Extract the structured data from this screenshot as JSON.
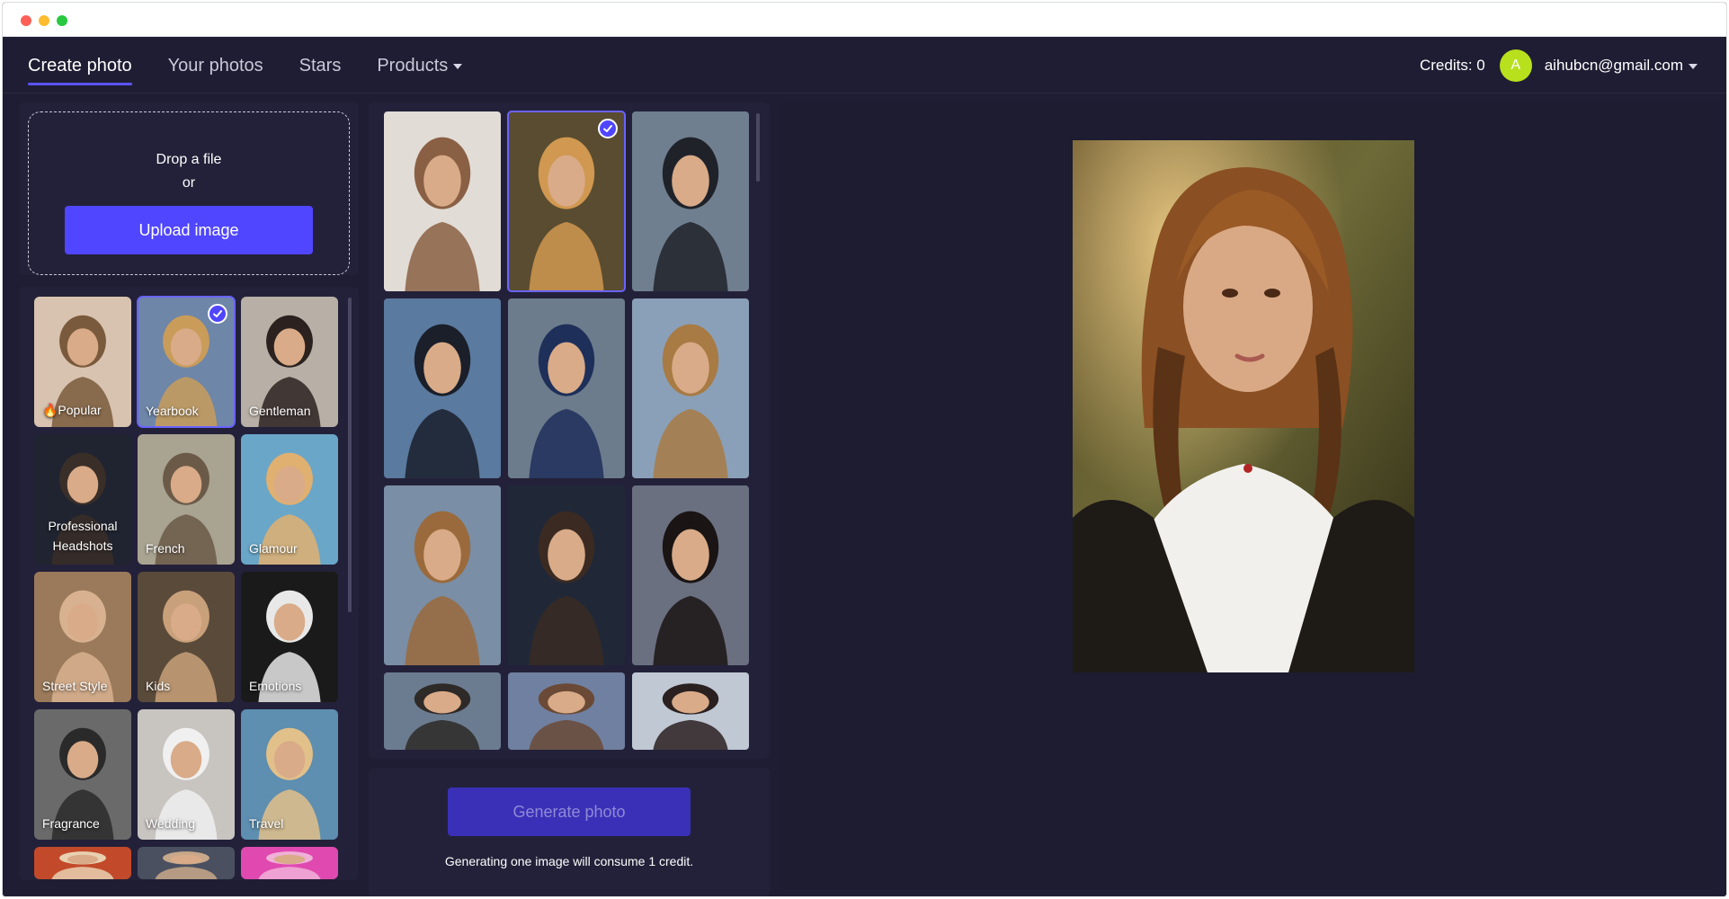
{
  "nav": {
    "items": [
      {
        "label": "Create photo",
        "active": true
      },
      {
        "label": "Your photos",
        "active": false
      },
      {
        "label": "Stars",
        "active": false
      },
      {
        "label": "Products",
        "active": false,
        "has_dropdown": true
      }
    ]
  },
  "account": {
    "credits_label": "Credits: 0",
    "avatar_initial": "A",
    "avatar_color": "#b8e01c",
    "email": "aihubcn@gmail.com"
  },
  "upload": {
    "drop_line1": "Drop a file",
    "drop_line2": "or",
    "button_label": "Upload image"
  },
  "styles": [
    {
      "label": "🔥Popular",
      "selected": false
    },
    {
      "label": "Yearbook",
      "selected": true
    },
    {
      "label": "Gentleman",
      "selected": false
    },
    {
      "label": "Professional Headshots",
      "selected": false
    },
    {
      "label": "French",
      "selected": false
    },
    {
      "label": "Glamour",
      "selected": false
    },
    {
      "label": "Street Style",
      "selected": false
    },
    {
      "label": "Kids",
      "selected": false
    },
    {
      "label": "Emotions",
      "selected": false
    },
    {
      "label": "Fragrance",
      "selected": false
    },
    {
      "label": "Wedding",
      "selected": false
    },
    {
      "label": "Travel",
      "selected": false
    },
    {
      "label": "",
      "selected": false
    },
    {
      "label": "",
      "selected": false
    },
    {
      "label": "",
      "selected": false
    }
  ],
  "photos": [
    {
      "selected": false
    },
    {
      "selected": true
    },
    {
      "selected": false
    },
    {
      "selected": false
    },
    {
      "selected": false
    },
    {
      "selected": false
    },
    {
      "selected": false
    },
    {
      "selected": false
    },
    {
      "selected": false
    },
    {
      "selected": false
    },
    {
      "selected": false
    },
    {
      "selected": false
    }
  ],
  "generate": {
    "button_label": "Generate photo",
    "note": "Generating one image will consume 1 credit."
  },
  "accent_color": "#5046ff"
}
